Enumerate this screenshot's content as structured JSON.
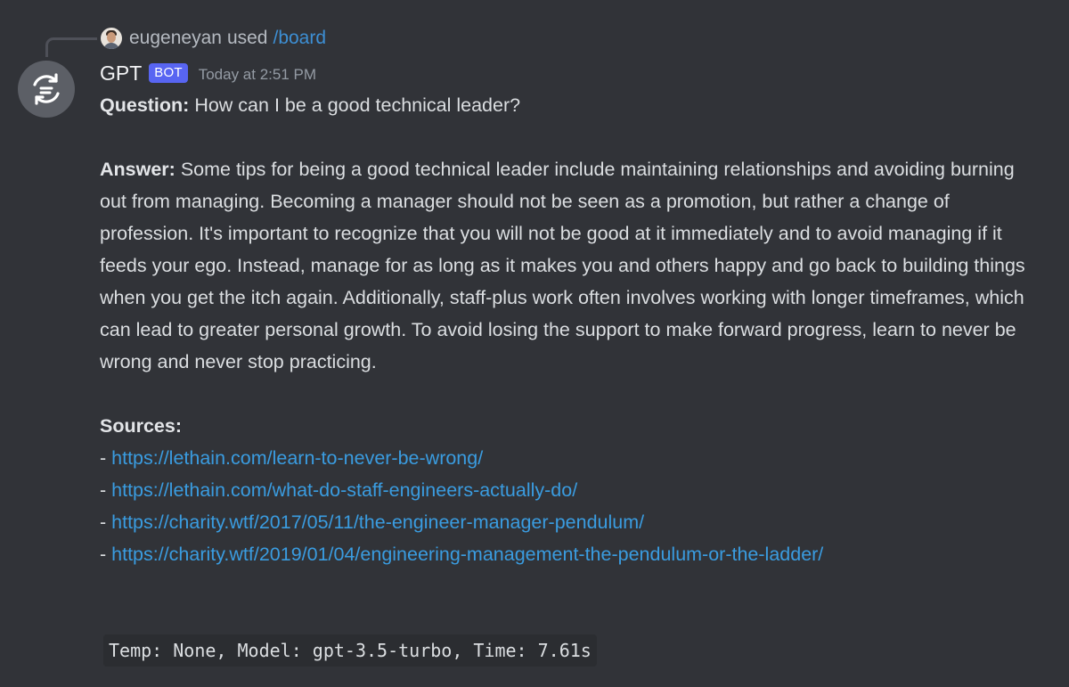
{
  "reply": {
    "username": "eugeneyan",
    "action": "used",
    "command": "/board"
  },
  "message": {
    "author": "GPT",
    "bot_tag": "BOT",
    "timestamp": "Today at 2:51 PM",
    "question_label": "Question:",
    "question_text": "How can I be a good technical leader?",
    "answer_label": "Answer:",
    "answer_text": "Some tips for being a good technical leader include maintaining relationships and avoiding burning out from managing. Becoming a manager should not be seen as a promotion, but rather a change of profession. It's important to recognize that you will not be good at it immediately and to avoid managing if it feeds your ego. Instead, manage for as long as it makes you and others happy and go back to building things when you get the itch again. Additionally, staff-plus work often involves working with longer timeframes, which can lead to greater personal growth. To avoid losing the support to make forward progress, learn to never be wrong and never stop practicing.",
    "sources_label": "Sources:",
    "sources": [
      {
        "prefix": "- ",
        "url": "https://lethain.com/learn-to-never-be-wrong/"
      },
      {
        "prefix": "- ",
        "url": "https://lethain.com/what-do-staff-engineers-actually-do/"
      },
      {
        "prefix": "- ",
        "url": "https://charity.wtf/2017/05/11/the-engineer-manager-pendulum/"
      },
      {
        "prefix": "- ",
        "url": "https://charity.wtf/2019/01/04/engineering-management-the-pendulum-or-the-ladder/"
      }
    ],
    "footer_code": "Temp: None, Model: gpt-3.5-turbo, Time: 7.61s"
  },
  "icons": {
    "bot_avatar": "cycle-arrows-icon",
    "user_avatar": "user-photo-icon"
  },
  "colors": {
    "background": "#313338",
    "link": "#3a9ce0",
    "command": "#3d8fd4",
    "bot_tag": "#5865f2",
    "avatar_bg": "#5c5f66"
  }
}
